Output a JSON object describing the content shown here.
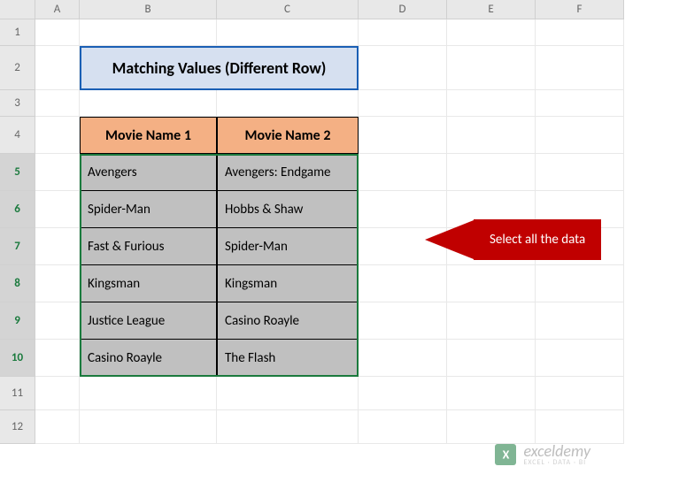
{
  "columns": [
    "A",
    "B",
    "C",
    "D",
    "E",
    "F"
  ],
  "rows": [
    "1",
    "2",
    "3",
    "4",
    "5",
    "6",
    "7",
    "8",
    "9",
    "10",
    "11",
    "12"
  ],
  "selected_rows": [
    5,
    6,
    7,
    8,
    9,
    10
  ],
  "title": "Matching Values (Different Row)",
  "table": {
    "headers": [
      "Movie Name 1",
      "Movie Name 2"
    ],
    "data": [
      [
        "Avengers",
        "Avengers: Endgame"
      ],
      [
        "Spider-Man",
        "Hobbs & Shaw"
      ],
      [
        "Fast & Furious",
        "Spider-Man"
      ],
      [
        "Kingsman",
        "Kingsman"
      ],
      [
        "Justice League",
        "Casino Roayle"
      ],
      [
        "Casino Roayle",
        "The Flash"
      ]
    ]
  },
  "callout": "Select all the data",
  "watermark": {
    "main": "exceldemy",
    "sub": "EXCEL · DATA · BI"
  },
  "chart_data": {
    "type": "table",
    "title": "Matching Values (Different Row)",
    "columns": [
      "Movie Name 1",
      "Movie Name 2"
    ],
    "rows": [
      {
        "Movie Name 1": "Avengers",
        "Movie Name 2": "Avengers: Endgame"
      },
      {
        "Movie Name 1": "Spider-Man",
        "Movie Name 2": "Hobbs & Shaw"
      },
      {
        "Movie Name 1": "Fast & Furious",
        "Movie Name 2": "Spider-Man"
      },
      {
        "Movie Name 1": "Kingsman",
        "Movie Name 2": "Kingsman"
      },
      {
        "Movie Name 1": "Justice League",
        "Movie Name 2": "Casino Roayle"
      },
      {
        "Movie Name 1": "Casino Roayle",
        "Movie Name 2": "The Flash"
      }
    ]
  }
}
